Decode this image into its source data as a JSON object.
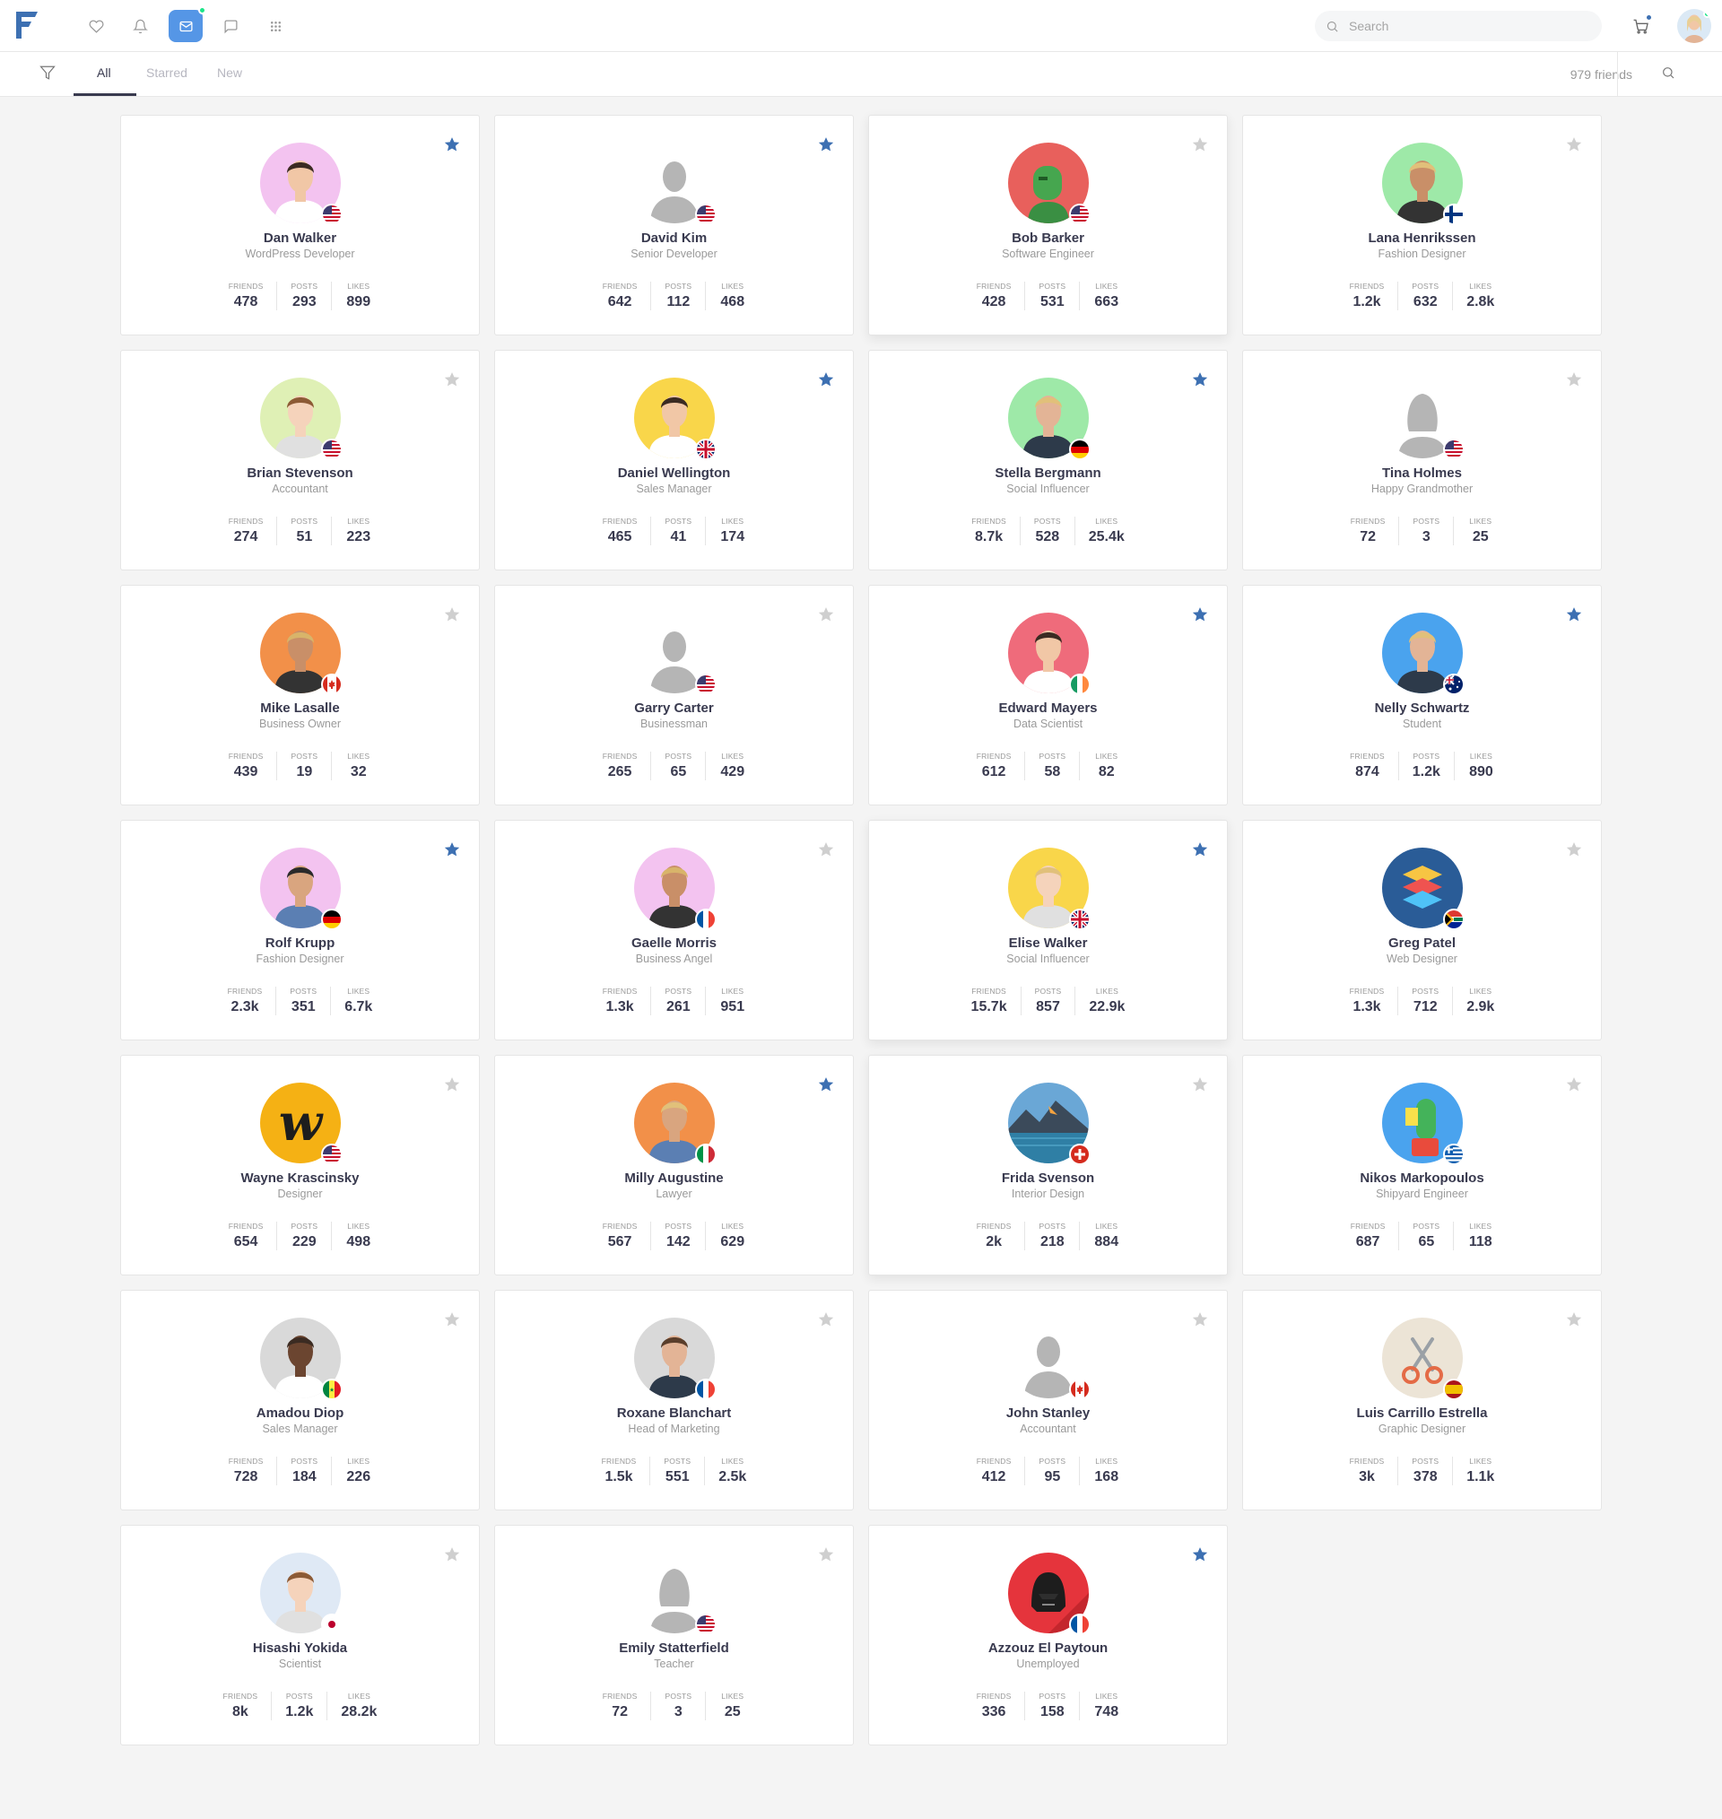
{
  "nav": {
    "search_placeholder": "Search",
    "accent_color": "#5596e6",
    "icons": [
      "heart-icon",
      "bell-icon",
      "envelope-icon",
      "chat-icon",
      "apps-grid-icon"
    ]
  },
  "subnav": {
    "tabs": [
      "All",
      "Starred",
      "New"
    ],
    "active_tab": "All",
    "friends_count": "979 friends"
  },
  "stat_labels": {
    "friends": "FRIENDS",
    "posts": "POSTS",
    "likes": "LIKES"
  },
  "friends": [
    {
      "name": "Dan Walker",
      "role": "WordPress Developer",
      "friends": "478",
      "posts": "293",
      "likes": "899",
      "starred": true,
      "flag": "us",
      "avatar_bg": "#f3c3f0"
    },
    {
      "name": "David Kim",
      "role": "Senior Developer",
      "friends": "642",
      "posts": "112",
      "likes": "468",
      "starred": true,
      "flag": "us",
      "avatar_bg": "#ffffff"
    },
    {
      "name": "Bob Barker",
      "role": "Software Engineer",
      "friends": "428",
      "posts": "531",
      "likes": "663",
      "starred": false,
      "flag": "us",
      "avatar_bg": "#e8605c"
    },
    {
      "name": "Lana Henrikssen",
      "role": "Fashion Designer",
      "friends": "1.2k",
      "posts": "632",
      "likes": "2.8k",
      "starred": false,
      "flag": "fi",
      "avatar_bg": "#9ee9a8"
    },
    {
      "name": "Brian Stevenson",
      "role": "Accountant",
      "friends": "274",
      "posts": "51",
      "likes": "223",
      "starred": false,
      "flag": "us",
      "avatar_bg": "#dff0b5"
    },
    {
      "name": "Daniel Wellington",
      "role": "Sales Manager",
      "friends": "465",
      "posts": "41",
      "likes": "174",
      "starred": true,
      "flag": "gb",
      "avatar_bg": "#f9d64a"
    },
    {
      "name": "Stella Bergmann",
      "role": "Social Influencer",
      "friends": "8.7k",
      "posts": "528",
      "likes": "25.4k",
      "starred": true,
      "flag": "de",
      "avatar_bg": "#9ee9a8"
    },
    {
      "name": "Tina Holmes",
      "role": "Happy Grandmother",
      "friends": "72",
      "posts": "3",
      "likes": "25",
      "starred": false,
      "flag": "us",
      "avatar_bg": "#ffffff"
    },
    {
      "name": "Mike Lasalle",
      "role": "Business Owner",
      "friends": "439",
      "posts": "19",
      "likes": "32",
      "starred": false,
      "flag": "ca",
      "avatar_bg": "#f29049"
    },
    {
      "name": "Garry Carter",
      "role": "Businessman",
      "friends": "265",
      "posts": "65",
      "likes": "429",
      "starred": false,
      "flag": "us",
      "avatar_bg": "#ffffff"
    },
    {
      "name": "Edward Mayers",
      "role": "Data Scientist",
      "friends": "612",
      "posts": "58",
      "likes": "82",
      "starred": true,
      "flag": "ie",
      "avatar_bg": "#ef6b7b"
    },
    {
      "name": "Nelly Schwartz",
      "role": "Student",
      "friends": "874",
      "posts": "1.2k",
      "likes": "890",
      "starred": true,
      "flag": "au",
      "avatar_bg": "#4aa3ee"
    },
    {
      "name": "Rolf Krupp",
      "role": "Fashion Designer",
      "friends": "2.3k",
      "posts": "351",
      "likes": "6.7k",
      "starred": true,
      "flag": "de",
      "avatar_bg": "#f3c3f0"
    },
    {
      "name": "Gaelle Morris",
      "role": "Business Angel",
      "friends": "1.3k",
      "posts": "261",
      "likes": "951",
      "starred": false,
      "flag": "fr",
      "avatar_bg": "#f3c3f0"
    },
    {
      "name": "Elise Walker",
      "role": "Social Influencer",
      "friends": "15.7k",
      "posts": "857",
      "likes": "22.9k",
      "starred": true,
      "flag": "gb",
      "avatar_bg": "#f9d64a"
    },
    {
      "name": "Greg Patel",
      "role": "Web Designer",
      "friends": "1.3k",
      "posts": "712",
      "likes": "2.9k",
      "starred": false,
      "flag": "za",
      "avatar_bg": "#2a5c97"
    },
    {
      "name": "Wayne Krascinsky",
      "role": "Designer",
      "friends": "654",
      "posts": "229",
      "likes": "498",
      "starred": false,
      "flag": "us",
      "avatar_bg": "#f5b114"
    },
    {
      "name": "Milly Augustine",
      "role": "Lawyer",
      "friends": "567",
      "posts": "142",
      "likes": "629",
      "starred": true,
      "flag": "it",
      "avatar_bg": "#f29049"
    },
    {
      "name": "Frida Svenson",
      "role": "Interior Design",
      "friends": "2k",
      "posts": "218",
      "likes": "884",
      "starred": false,
      "flag": "ch",
      "avatar_bg": "#3f7fb5"
    },
    {
      "name": "Nikos Markopoulos",
      "role": "Shipyard Engineer",
      "friends": "687",
      "posts": "65",
      "likes": "118",
      "starred": false,
      "flag": "gr",
      "avatar_bg": "#4aa3ee"
    },
    {
      "name": "Amadou Diop",
      "role": "Sales Manager",
      "friends": "728",
      "posts": "184",
      "likes": "226",
      "starred": false,
      "flag": "sn",
      "avatar_bg": "#d9d9d9"
    },
    {
      "name": "Roxane Blanchart",
      "role": "Head of Marketing",
      "friends": "1.5k",
      "posts": "551",
      "likes": "2.5k",
      "starred": false,
      "flag": "fr",
      "avatar_bg": "#d9d9d9"
    },
    {
      "name": "John Stanley",
      "role": "Accountant",
      "friends": "412",
      "posts": "95",
      "likes": "168",
      "starred": false,
      "flag": "ca",
      "avatar_bg": "#ffffff"
    },
    {
      "name": "Luis Carrillo Estrella",
      "role": "Graphic Designer",
      "friends": "3k",
      "posts": "378",
      "likes": "1.1k",
      "starred": false,
      "flag": "es",
      "avatar_bg": "#ece4d6"
    },
    {
      "name": "Hisashi Yokida",
      "role": "Scientist",
      "friends": "8k",
      "posts": "1.2k",
      "likes": "28.2k",
      "starred": false,
      "flag": "jp",
      "avatar_bg": "#dfe9f5"
    },
    {
      "name": "Emily Statterfield",
      "role": "Teacher",
      "friends": "72",
      "posts": "3",
      "likes": "25",
      "starred": false,
      "flag": "us",
      "avatar_bg": "#ffffff"
    },
    {
      "name": "Azzouz El Paytoun",
      "role": "Unemployed",
      "friends": "336",
      "posts": "158",
      "likes": "748",
      "starred": true,
      "flag": "fr",
      "avatar_bg": "#e5343c"
    }
  ],
  "colors": {
    "star_active": "#3d70b2",
    "star_inactive": "#cfcfcf",
    "text_dark": "#393a4f",
    "text_muted": "#9a9a9a"
  }
}
